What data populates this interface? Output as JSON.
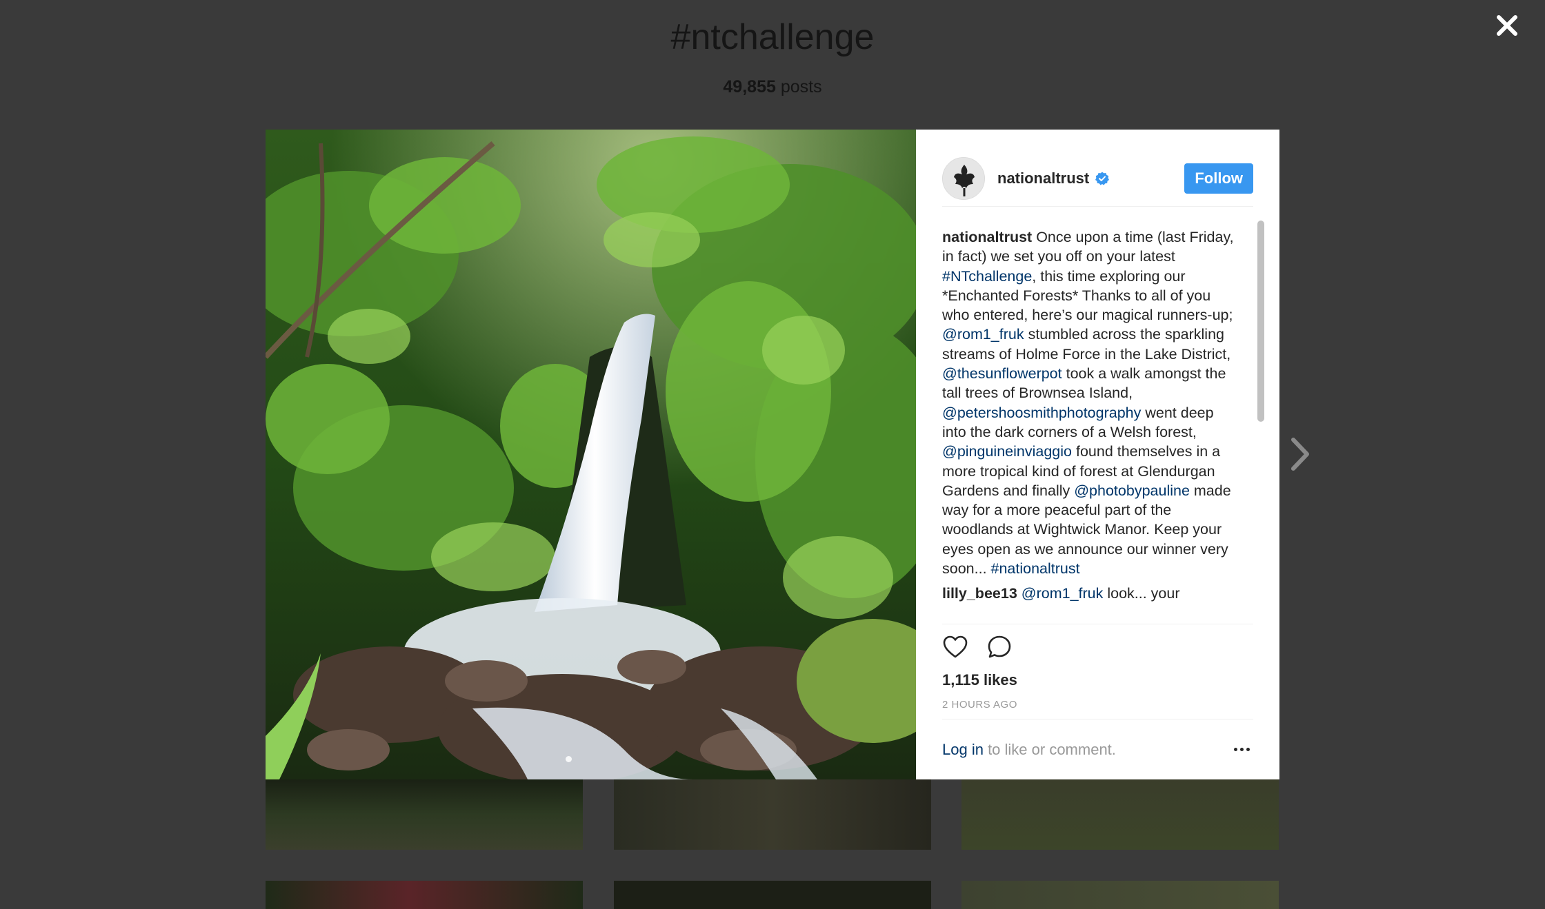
{
  "page": {
    "hashtag": "#ntchallenge",
    "post_count": "49,855",
    "post_count_label": "posts"
  },
  "post": {
    "username": "nationaltrust",
    "follow_label": "Follow",
    "caption": [
      {
        "t": "text",
        "v": "Once upon a time (last Friday, in fact) we set you off on your latest "
      },
      {
        "t": "link",
        "v": "#NTchallenge"
      },
      {
        "t": "text",
        "v": ", this time exploring our *Enchanted Forests* Thanks to all of you who entered, here’s our magical runners-up; "
      },
      {
        "t": "link",
        "v": "@rom1_fruk"
      },
      {
        "t": "text",
        "v": " stumbled across the sparkling streams of Holme Force in the Lake District, "
      },
      {
        "t": "link",
        "v": "@thesunflowerpot"
      },
      {
        "t": "text",
        "v": " took a walk amongst the tall trees of Brownsea Island, "
      },
      {
        "t": "link",
        "v": "@petershoosmithphotography"
      },
      {
        "t": "text",
        "v": " went deep into the dark corners of a Welsh forest, "
      },
      {
        "t": "link",
        "v": "@pinguineinviaggio"
      },
      {
        "t": "text",
        "v": " found themselves in a more tropical kind of forest at Glendurgan Gardens and finally "
      },
      {
        "t": "link",
        "v": "@photobypauline"
      },
      {
        "t": "text",
        "v": " made way for a more peaceful part of the woodlands at Wightwick Manor. Keep your eyes open as we announce our winner very soon... "
      },
      {
        "t": "link",
        "v": "#nationaltrust"
      }
    ],
    "comment": {
      "username": "lilly_bee13",
      "mention": "@rom1_fruk",
      "text": " look... your"
    },
    "likes": "1,115 likes",
    "time": "2 HOURS AGO",
    "login_label": "Log in",
    "login_suffix": " to like or comment."
  },
  "icons": {
    "close": "close-icon",
    "next": "chevron-right-icon",
    "verified": "verified-badge-icon",
    "like": "heart-icon",
    "comment": "comment-icon",
    "more": "more-options-icon"
  },
  "colors": {
    "overlay": "#3a3a3a",
    "follow": "#3897f0",
    "link": "#003569",
    "verified": "#3897f0"
  }
}
